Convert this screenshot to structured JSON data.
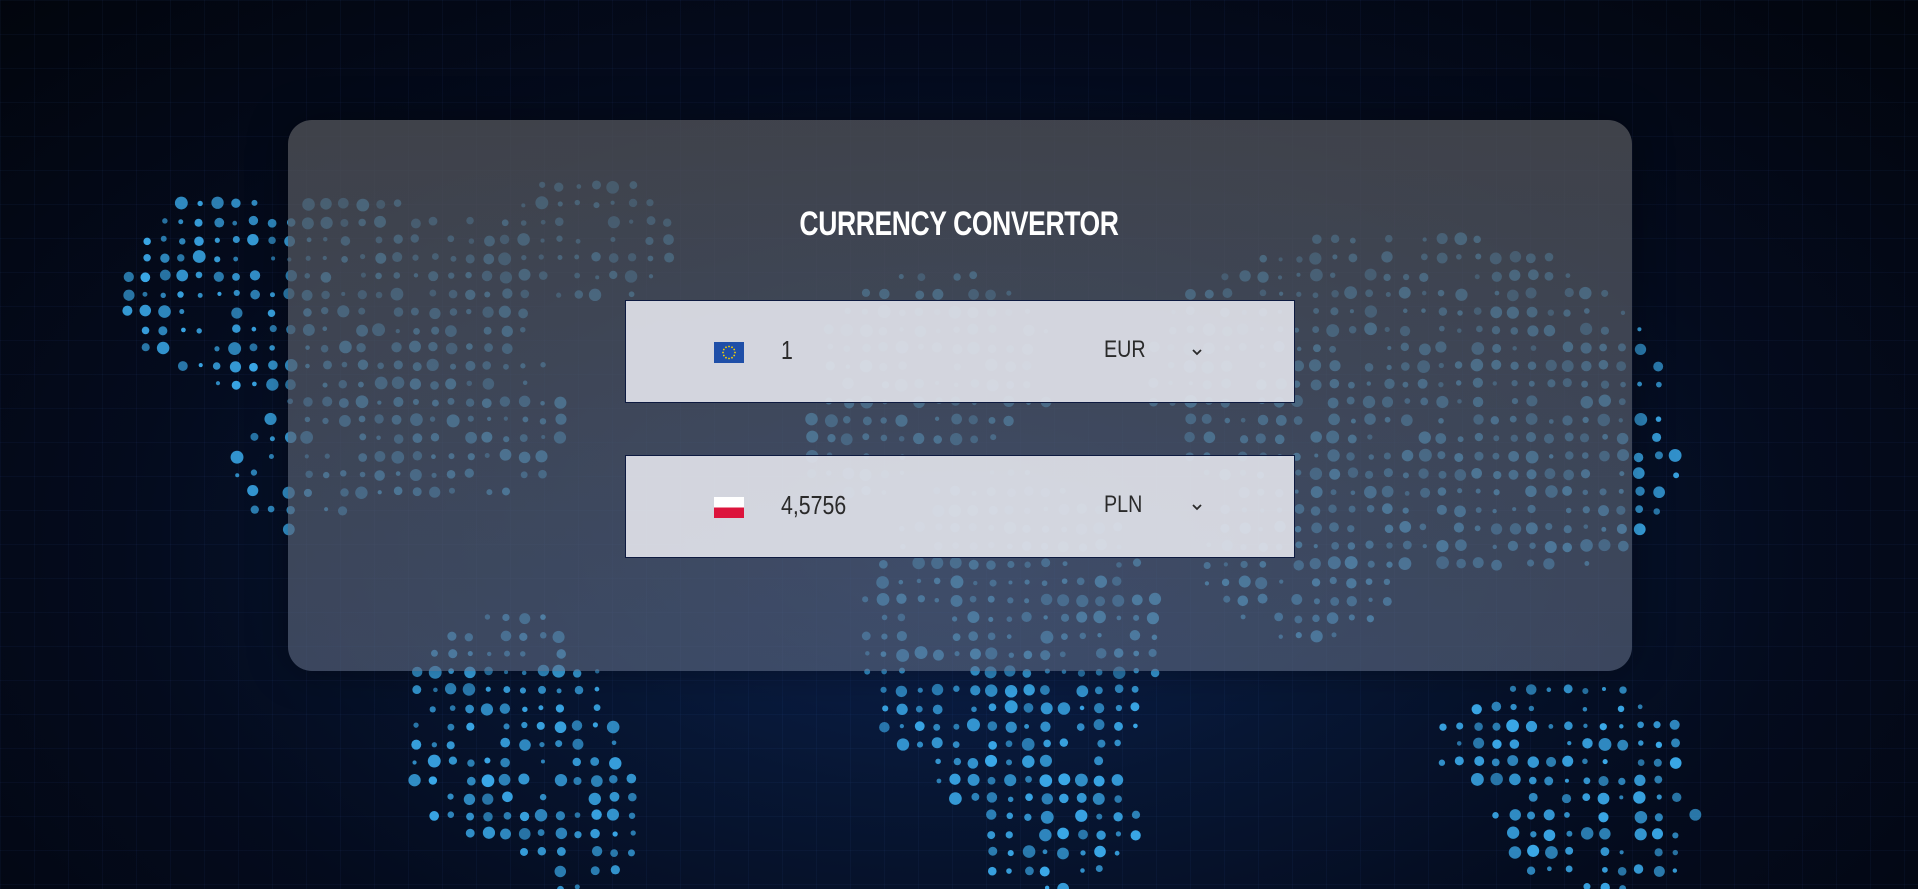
{
  "app": {
    "title": "CURRENCY CONVERTOR"
  },
  "colors": {
    "background": "#040b1d",
    "map_dots": "#3aa8e8",
    "panel": "#4e5056",
    "field_bg": "#dfe2e9",
    "field_border": "#0d1a40",
    "title_text": "#ffffff"
  },
  "converter": {
    "from": {
      "amount": "1",
      "currency": "EUR",
      "flag_icon": "eu-flag-icon"
    },
    "to": {
      "amount": "4,5756",
      "currency": "PLN",
      "flag_icon": "poland-flag-icon"
    }
  },
  "icons": {
    "dropdown": "chevron-down-icon"
  }
}
